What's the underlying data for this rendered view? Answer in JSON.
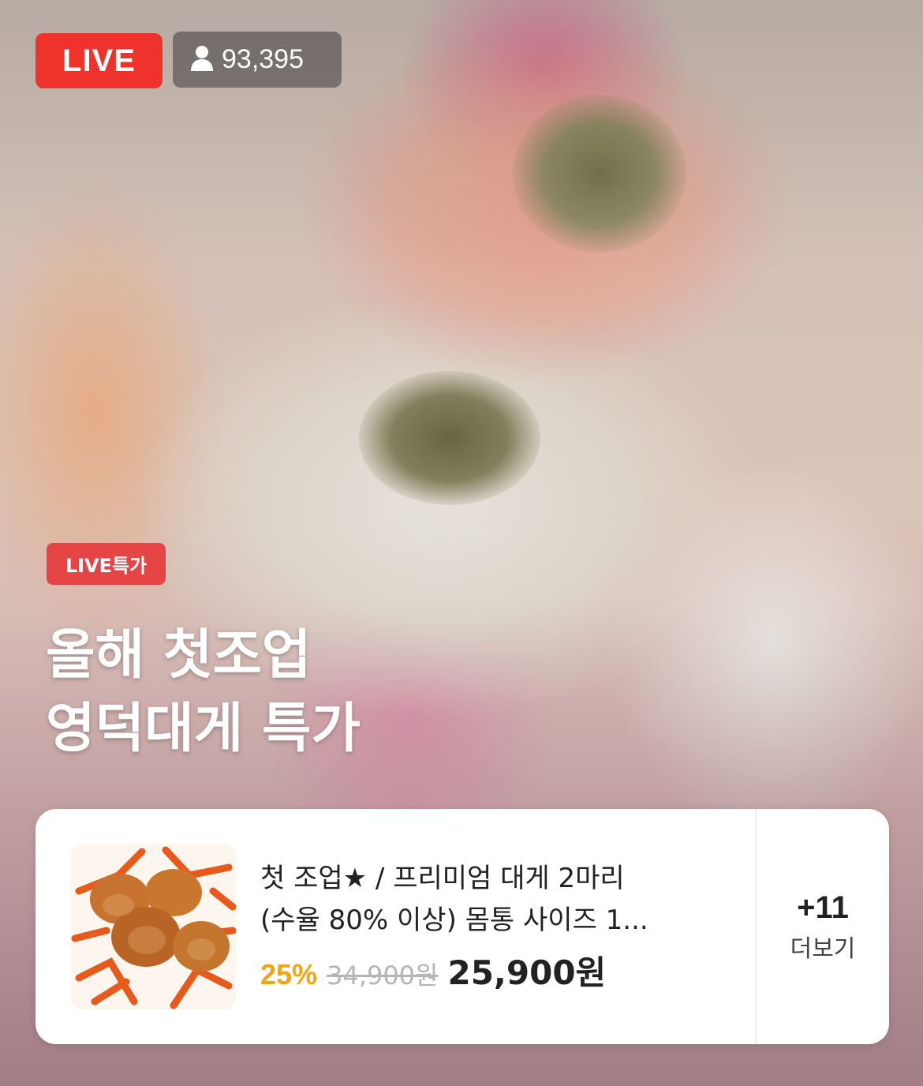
{
  "live": {
    "badge_label": "LIVE",
    "viewer_count": "93,395"
  },
  "promo": {
    "tag": "LIVE특가",
    "headline_line1": "올해 첫조업",
    "headline_line2": "영덕대게 특가"
  },
  "product": {
    "name_line1": "첫 조업★ / 프리미엄 대게 2마리",
    "name_line2": "(수율 80% 이상) 몸통 사이즈 1...",
    "discount": "25%",
    "original_price": "34,900원",
    "sale_price": "25,900원"
  },
  "more": {
    "count": "+11",
    "label": "더보기"
  },
  "colors": {
    "live_red": "#f0322c",
    "sale_tag": "#e64545",
    "discount_orange": "#f0a418"
  },
  "icons": {
    "viewer": "person-icon"
  }
}
